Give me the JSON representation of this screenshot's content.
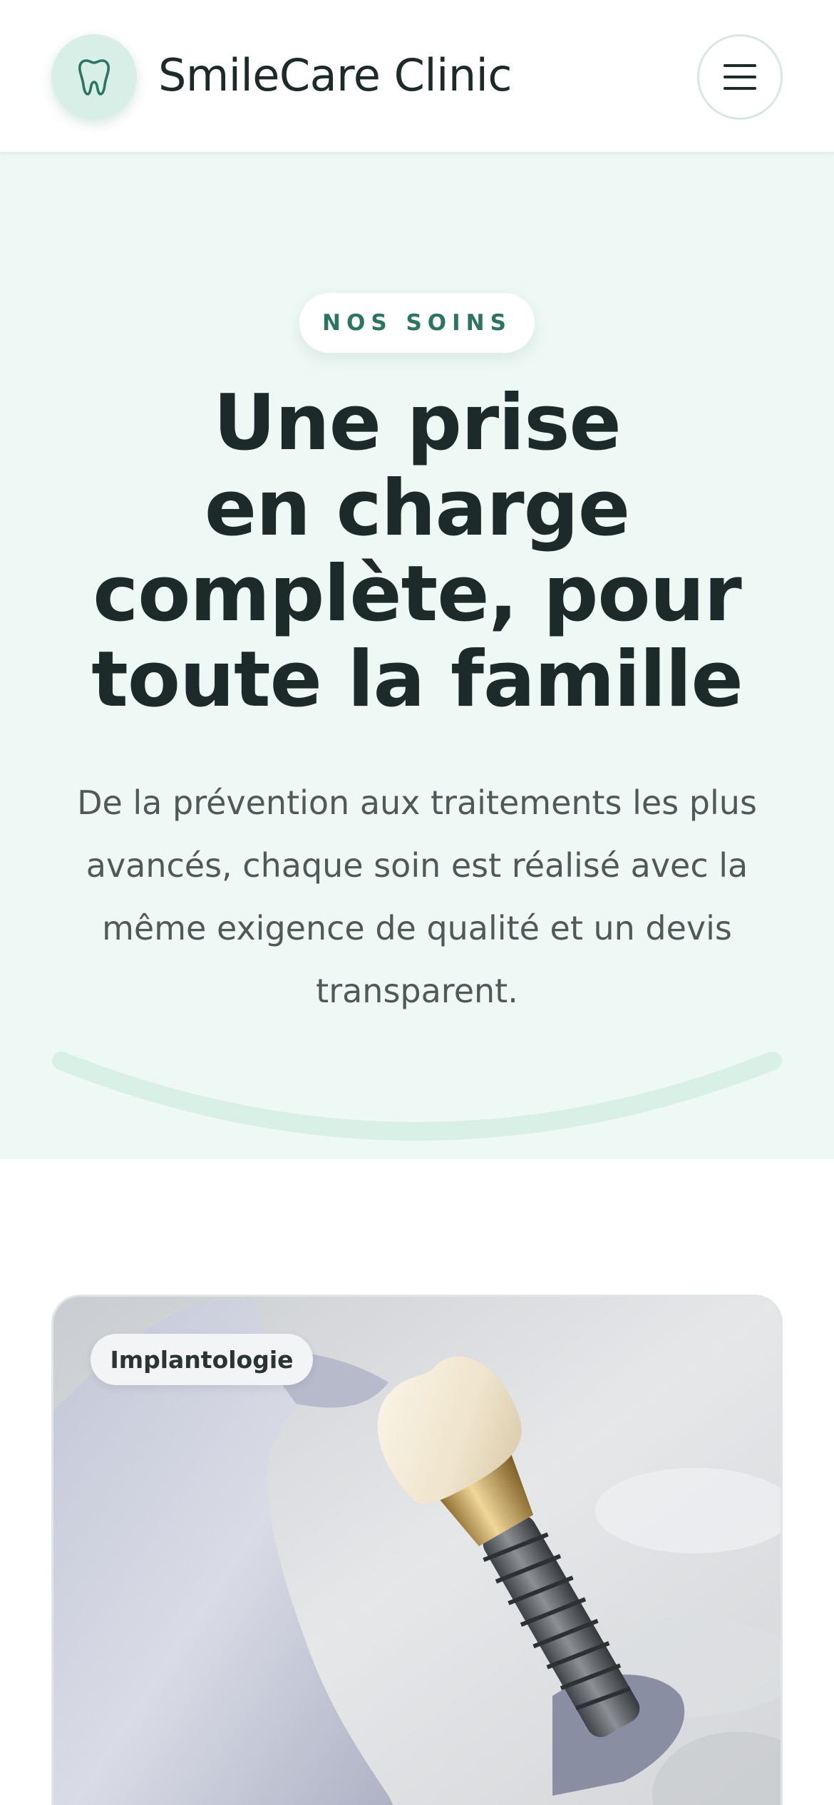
{
  "header": {
    "brand": "SmileCare Clinic",
    "logo_icon": "tooth-icon",
    "menu_icon": "hamburger-menu-icon"
  },
  "hero": {
    "eyebrow": "NOS SOINS",
    "title_lines": [
      "Une prise",
      "en charge",
      "complète, pour",
      "toute la famille"
    ],
    "text_lines": [
      "De la prévention aux traitements les plus",
      "avancés, chaque soin est réalisé avec la",
      "même exigence de qualité et un devis",
      "transparent."
    ]
  },
  "card": {
    "tag": "Implantologie",
    "image": "dental-implant-photo"
  },
  "colors": {
    "accent": "#2d7563",
    "hero_bg": "#eef8f4",
    "logo_bg": "#d8efe8",
    "text_dark": "#1c2b29",
    "text_body": "#4d5a57"
  }
}
